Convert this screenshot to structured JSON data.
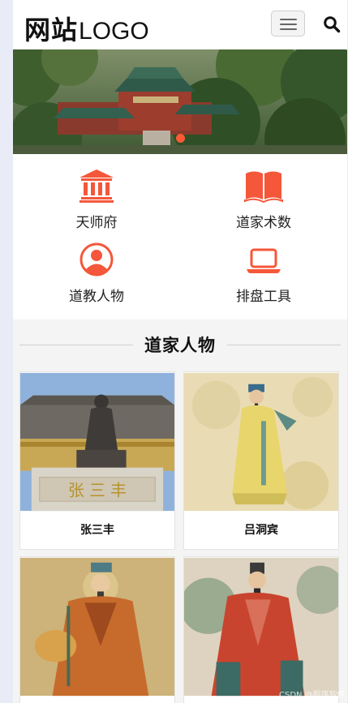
{
  "header": {
    "logo_cn": "网站",
    "logo_en": "LOGO"
  },
  "banner": {
    "slides": 1,
    "active_slide": 1
  },
  "categories": [
    {
      "label": "天师府",
      "icon": "building-icon"
    },
    {
      "label": "道家术数",
      "icon": "book-icon"
    },
    {
      "label": "道教人物",
      "icon": "user-icon"
    },
    {
      "label": "排盘工具",
      "icon": "laptop-icon"
    }
  ],
  "section": {
    "title": "道家人物",
    "cards": [
      {
        "name": "张三丰",
        "plaque": "张 三 丰"
      },
      {
        "name": "吕洞宾"
      },
      {
        "name": ""
      },
      {
        "name": ""
      }
    ]
  },
  "watermark": "CSDN @程序软件分享",
  "colors": {
    "accent": "#f4573a",
    "header_bg": "#ffffff",
    "section_bg": "#f4f4f4"
  }
}
